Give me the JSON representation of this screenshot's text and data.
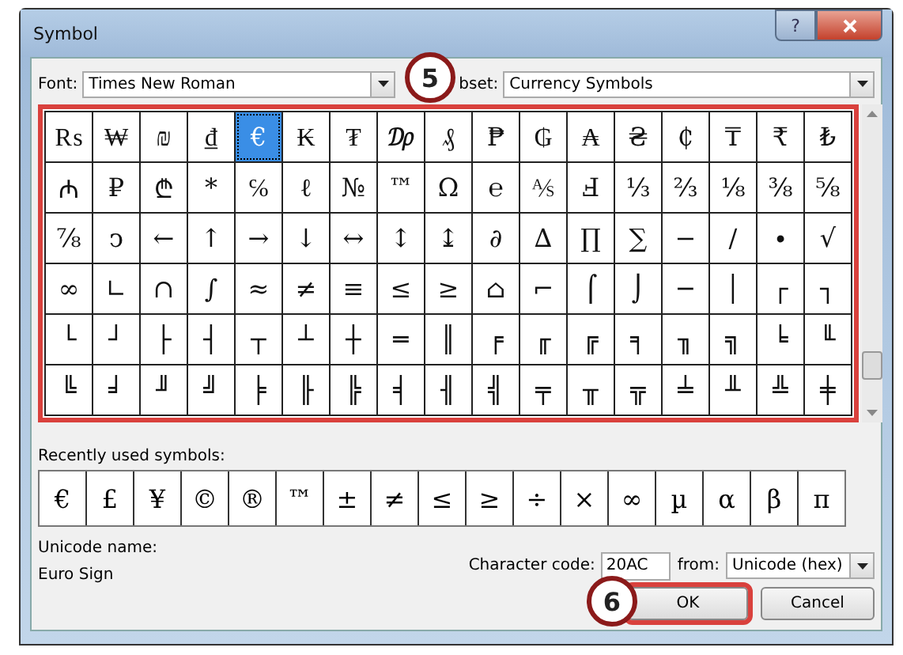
{
  "window": {
    "title": "Symbol"
  },
  "title_buttons": [
    {
      "kind": "help",
      "label": "?"
    },
    {
      "kind": "close"
    }
  ],
  "font_field": {
    "label": "Font:",
    "value": "Times New Roman"
  },
  "subset_field": {
    "label": "bset:",
    "value": "Currency Symbols"
  },
  "symbol_grid": {
    "highlighted": true,
    "rows": [
      {
        "cells": [
          {
            "symbol": "₨",
            "selected": false
          },
          {
            "symbol": "₩",
            "selected": false
          },
          {
            "symbol": "₪",
            "selected": false
          },
          {
            "symbol": "₫",
            "selected": false
          },
          {
            "symbol": "€",
            "selected": true
          },
          {
            "symbol": "₭",
            "selected": false
          },
          {
            "symbol": "₮",
            "selected": false
          },
          {
            "symbol": "₯",
            "selected": false
          },
          {
            "symbol": "₰",
            "selected": false
          },
          {
            "symbol": "₱",
            "selected": false
          },
          {
            "symbol": "₲",
            "selected": false
          },
          {
            "symbol": "₳",
            "selected": false
          },
          {
            "symbol": "₴",
            "selected": false
          },
          {
            "symbol": "₵",
            "selected": false
          },
          {
            "symbol": "₸",
            "selected": false
          },
          {
            "symbol": "₹",
            "selected": false
          },
          {
            "symbol": "₺",
            "selected": false
          }
        ]
      },
      {
        "cells": [
          {
            "symbol": "₼",
            "selected": false
          },
          {
            "symbol": "₽",
            "selected": false
          },
          {
            "symbol": "₾",
            "selected": false
          },
          {
            "symbol": "*",
            "selected": false
          },
          {
            "symbol": "℅",
            "selected": false
          },
          {
            "symbol": "ℓ",
            "selected": false
          },
          {
            "symbol": "№",
            "selected": false
          },
          {
            "symbol": "™",
            "selected": false
          },
          {
            "symbol": "Ω",
            "selected": false
          },
          {
            "symbol": "℮",
            "selected": false
          },
          {
            "symbol": "⅍",
            "selected": false
          },
          {
            "symbol": "Ⅎ",
            "selected": false
          },
          {
            "symbol": "⅓",
            "selected": false
          },
          {
            "symbol": "⅔",
            "selected": false
          },
          {
            "symbol": "⅛",
            "selected": false
          },
          {
            "symbol": "⅜",
            "selected": false
          },
          {
            "symbol": "⅝",
            "selected": false
          }
        ]
      },
      {
        "cells": [
          {
            "symbol": "⅞",
            "selected": false
          },
          {
            "symbol": "ↄ",
            "selected": false
          },
          {
            "symbol": "←",
            "selected": false
          },
          {
            "symbol": "↑",
            "selected": false
          },
          {
            "symbol": "→",
            "selected": false
          },
          {
            "symbol": "↓",
            "selected": false
          },
          {
            "symbol": "↔",
            "selected": false
          },
          {
            "symbol": "↕",
            "selected": false
          },
          {
            "symbol": "↨",
            "selected": false
          },
          {
            "symbol": "∂",
            "selected": false
          },
          {
            "symbol": "∆",
            "selected": false
          },
          {
            "symbol": "∏",
            "selected": false
          },
          {
            "symbol": "∑",
            "selected": false
          },
          {
            "symbol": "−",
            "selected": false
          },
          {
            "symbol": "∕",
            "selected": false
          },
          {
            "symbol": "∙",
            "selected": false
          },
          {
            "symbol": "√",
            "selected": false
          }
        ]
      },
      {
        "cells": [
          {
            "symbol": "∞",
            "selected": false
          },
          {
            "symbol": "∟",
            "selected": false
          },
          {
            "symbol": "∩",
            "selected": false
          },
          {
            "symbol": "∫",
            "selected": false
          },
          {
            "symbol": "≈",
            "selected": false
          },
          {
            "symbol": "≠",
            "selected": false
          },
          {
            "symbol": "≡",
            "selected": false
          },
          {
            "symbol": "≤",
            "selected": false
          },
          {
            "symbol": "≥",
            "selected": false
          },
          {
            "symbol": "⌂",
            "selected": false
          },
          {
            "symbol": "⌐",
            "selected": false
          },
          {
            "symbol": "⌠",
            "selected": false
          },
          {
            "symbol": "⌡",
            "selected": false
          },
          {
            "symbol": "─",
            "selected": false
          },
          {
            "symbol": "│",
            "selected": false
          },
          {
            "symbol": "┌",
            "selected": false
          },
          {
            "symbol": "┐",
            "selected": false
          }
        ]
      },
      {
        "cells": [
          {
            "symbol": "└",
            "selected": false
          },
          {
            "symbol": "┘",
            "selected": false
          },
          {
            "symbol": "├",
            "selected": false
          },
          {
            "symbol": "┤",
            "selected": false
          },
          {
            "symbol": "┬",
            "selected": false
          },
          {
            "symbol": "┴",
            "selected": false
          },
          {
            "symbol": "┼",
            "selected": false
          },
          {
            "symbol": "═",
            "selected": false
          },
          {
            "symbol": "║",
            "selected": false
          },
          {
            "symbol": "╒",
            "selected": false
          },
          {
            "symbol": "╓",
            "selected": false
          },
          {
            "symbol": "╔",
            "selected": false
          },
          {
            "symbol": "╕",
            "selected": false
          },
          {
            "symbol": "╖",
            "selected": false
          },
          {
            "symbol": "╗",
            "selected": false
          },
          {
            "symbol": "╘",
            "selected": false
          },
          {
            "symbol": "╙",
            "selected": false
          }
        ]
      },
      {
        "cells": [
          {
            "symbol": "╚",
            "selected": false
          },
          {
            "symbol": "╛",
            "selected": false
          },
          {
            "symbol": "╜",
            "selected": false
          },
          {
            "symbol": "╝",
            "selected": false
          },
          {
            "symbol": "╞",
            "selected": false
          },
          {
            "symbol": "╟",
            "selected": false
          },
          {
            "symbol": "╠",
            "selected": false
          },
          {
            "symbol": "╡",
            "selected": false
          },
          {
            "symbol": "╢",
            "selected": false
          },
          {
            "symbol": "╣",
            "selected": false
          },
          {
            "symbol": "╤",
            "selected": false
          },
          {
            "symbol": "╥",
            "selected": false
          },
          {
            "symbol": "╦",
            "selected": false
          },
          {
            "symbol": "╧",
            "selected": false
          },
          {
            "symbol": "╨",
            "selected": false
          },
          {
            "symbol": "╩",
            "selected": false
          },
          {
            "symbol": "╪",
            "selected": false
          }
        ]
      }
    ]
  },
  "recent": {
    "label": "Recently used symbols:",
    "symbols": [
      "€",
      "£",
      "¥",
      "©",
      "®",
      "™",
      "±",
      "≠",
      "≤",
      "≥",
      "÷",
      "×",
      "∞",
      "µ",
      "α",
      "β",
      "π"
    ]
  },
  "unicode_name": {
    "label": "Unicode name:",
    "value": "Euro Sign"
  },
  "character_code": {
    "label": "Character code:",
    "value": "20AC"
  },
  "from_field": {
    "label": "from:",
    "value": "Unicode (hex)"
  },
  "buttons": [
    {
      "kind": "ok",
      "label": "OK",
      "highlighted": true
    },
    {
      "kind": "cancel",
      "label": "Cancel",
      "highlighted": false
    }
  ],
  "callouts": [
    {
      "kind": "grid",
      "label": "5"
    },
    {
      "kind": "ok",
      "label": "6"
    }
  ]
}
